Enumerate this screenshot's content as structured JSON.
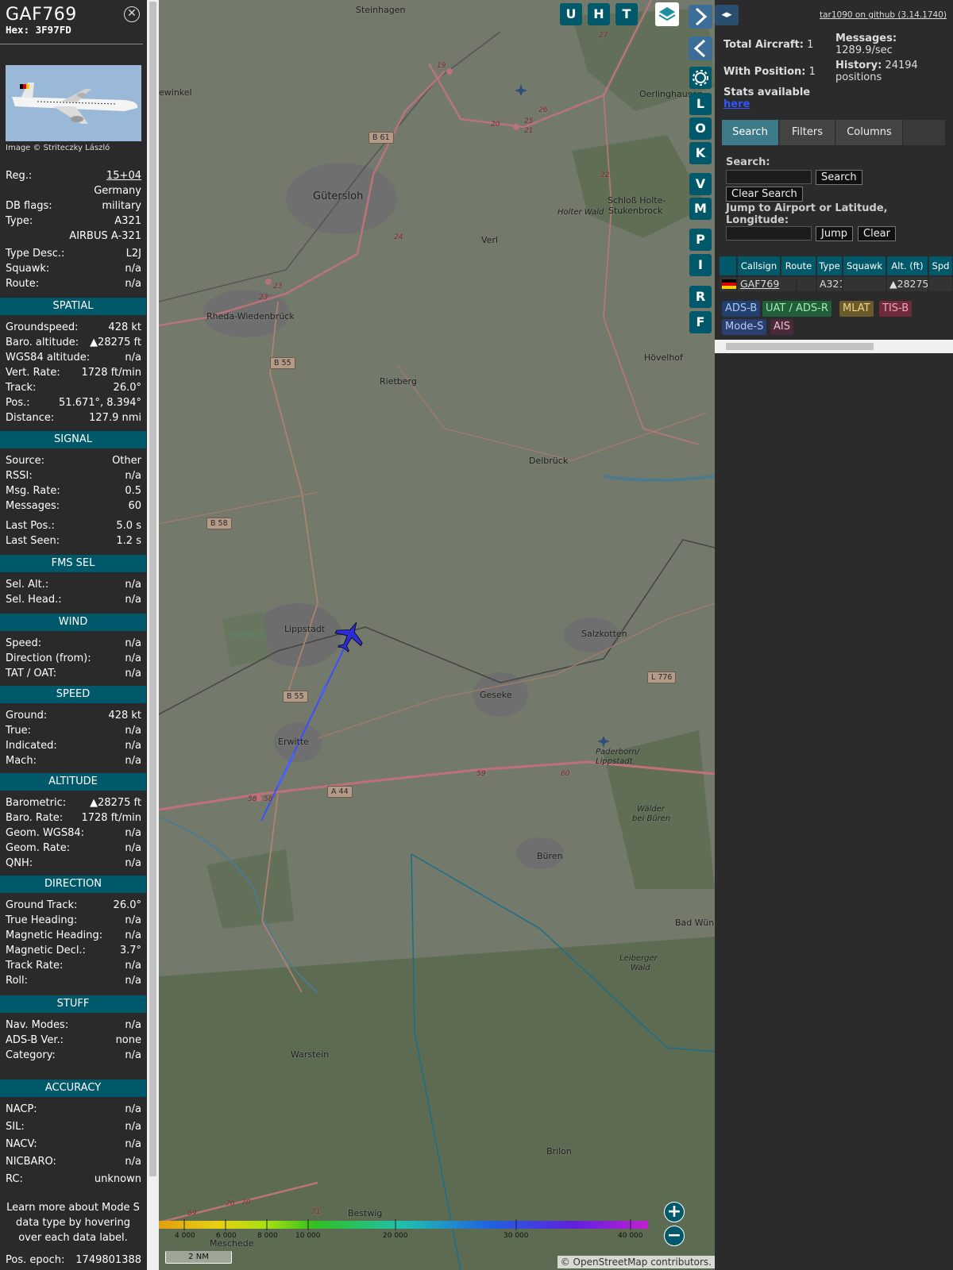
{
  "aircraft": {
    "callsign": "GAF769",
    "hex_label": "Hex: 3F97FD",
    "close_icon": "close-circle-icon",
    "image_credit": "Image © Striteczky László",
    "reg_label": "Reg.:",
    "reg_value": "15+04",
    "country": "Germany",
    "db_flags_label": "DB flags:",
    "db_flags_value": "military",
    "type_label": "Type:",
    "type_value": "A321",
    "type_full": "AIRBUS A-321",
    "type_desc_label": "Type Desc.:",
    "type_desc_value": "L2J",
    "squawk_label": "Squawk:",
    "squawk_value": "n/a",
    "route_label": "Route:",
    "route_value": "n/a"
  },
  "sections": {
    "spatial": {
      "title": "SPATIAL",
      "rows": [
        {
          "k": "Groundspeed:",
          "v": "428 kt"
        },
        {
          "k": "Baro. altitude:",
          "v": "▲28275 ft"
        },
        {
          "k": "WGS84 altitude:",
          "v": "n/a"
        },
        {
          "k": "Vert. Rate:",
          "v": "1728 ft/min"
        },
        {
          "k": "Track:",
          "v": "26.0°"
        },
        {
          "k": "Pos.:",
          "v": "51.671°, 8.394°"
        },
        {
          "k": "Distance:",
          "v": "127.9 nmi"
        }
      ]
    },
    "signal": {
      "title": "SIGNAL",
      "rows": [
        {
          "k": "Source:",
          "v": "Other"
        },
        {
          "k": "RSSI:",
          "v": "n/a"
        },
        {
          "k": "Msg. Rate:",
          "v": "0.5"
        },
        {
          "k": "Messages:",
          "v": "60"
        },
        {
          "k": "Last Pos.:",
          "v": "5.0 s"
        },
        {
          "k": "Last Seen:",
          "v": "1.2 s"
        }
      ]
    },
    "fms": {
      "title": "FMS SEL",
      "rows": [
        {
          "k": "Sel. Alt.:",
          "v": "n/a"
        },
        {
          "k": "Sel. Head.:",
          "v": "n/a"
        }
      ]
    },
    "wind": {
      "title": "WIND",
      "rows": [
        {
          "k": "Speed:",
          "v": "n/a"
        },
        {
          "k": "Direction (from):",
          "v": "n/a"
        },
        {
          "k": "TAT / OAT:",
          "v": "n/a"
        }
      ]
    },
    "speed": {
      "title": "SPEED",
      "rows": [
        {
          "k": "Ground:",
          "v": "428 kt"
        },
        {
          "k": "True:",
          "v": "n/a"
        },
        {
          "k": "Indicated:",
          "v": "n/a"
        },
        {
          "k": "Mach:",
          "v": "n/a"
        }
      ]
    },
    "altitude": {
      "title": "ALTITUDE",
      "rows": [
        {
          "k": "Barometric:",
          "v": "▲28275 ft"
        },
        {
          "k": "Baro. Rate:",
          "v": "1728 ft/min"
        },
        {
          "k": "Geom. WGS84:",
          "v": "n/a"
        },
        {
          "k": "Geom. Rate:",
          "v": "n/a"
        },
        {
          "k": "QNH:",
          "v": "n/a"
        }
      ]
    },
    "direction": {
      "title": "DIRECTION",
      "rows": [
        {
          "k": "Ground Track:",
          "v": "26.0°"
        },
        {
          "k": "True Heading:",
          "v": "n/a"
        },
        {
          "k": "Magnetic Heading:",
          "v": "n/a"
        },
        {
          "k": "Magnetic Decl.:",
          "v": "3.7°"
        },
        {
          "k": "Track Rate:",
          "v": "n/a"
        },
        {
          "k": "Roll:",
          "v": "n/a"
        }
      ]
    },
    "stuff": {
      "title": "STUFF",
      "rows": [
        {
          "k": "Nav. Modes:",
          "v": "n/a"
        },
        {
          "k": "ADS-B Ver.:",
          "v": "none"
        },
        {
          "k": "Category:",
          "v": "n/a"
        }
      ]
    },
    "accuracy": {
      "title": "ACCURACY",
      "rows": [
        {
          "k": "NACP:",
          "v": "n/a"
        },
        {
          "k": "SIL:",
          "v": "n/a"
        },
        {
          "k": "NACV:",
          "v": "n/a"
        },
        {
          "k": "NICBARO:",
          "v": "n/a"
        },
        {
          "k": "RC:",
          "v": "unknown"
        }
      ]
    }
  },
  "learn_more": "Learn more about Mode S data type by hovering over each data label.",
  "pos_epoch_label": "Pos. epoch:",
  "pos_epoch_value": "1749801388",
  "map": {
    "top_buttons": [
      "U",
      "H",
      "T"
    ],
    "layers_icon": "layers-icon",
    "side_buttons": [
      "L",
      "O",
      "K",
      "V",
      "M",
      "P",
      "I",
      "R",
      "F"
    ],
    "settings_icon": "gear-icon",
    "expand_icon": "chevron-right-icon",
    "collapse_icon": "chevron-left-icon",
    "places": [
      {
        "name": "Steinhagen"
      },
      {
        "name": "ewinkel"
      },
      {
        "name": "Gütersloh"
      },
      {
        "name": "Oerlinghausen"
      },
      {
        "name": "Schloß Holte-"
      },
      {
        "name": "Stukenbrock"
      },
      {
        "name": "Holter Wald"
      },
      {
        "name": "Verl"
      },
      {
        "name": "Rheda-Wiedenbrück"
      },
      {
        "name": "Rietberg"
      },
      {
        "name": "Hövelhof"
      },
      {
        "name": "Delbrück"
      },
      {
        "name": "Lippstadt"
      },
      {
        "name": "Lippeaue"
      },
      {
        "name": "Salzkotten"
      },
      {
        "name": "Geseke"
      },
      {
        "name": "Erwitte"
      },
      {
        "name": "Paderborn/"
      },
      {
        "name": "Lippstadt"
      },
      {
        "name": "Büren"
      },
      {
        "name": "Wälder"
      },
      {
        "name": "bei Büren"
      },
      {
        "name": "Bad Wünn"
      },
      {
        "name": "Leiberger"
      },
      {
        "name": "Wald"
      },
      {
        "name": "Warstein"
      },
      {
        "name": "Brilon"
      },
      {
        "name": "Bestwig"
      },
      {
        "name": "Meschede"
      }
    ],
    "road_signs": [
      "B 61",
      "B 55",
      "B 58",
      "B 55",
      "A 44",
      "L 776"
    ],
    "junction_numbers": [
      "27",
      "19",
      "26",
      "25",
      "20",
      "21",
      "22",
      "24",
      "23",
      "23",
      "58",
      "58",
      "59",
      "60",
      "69",
      "70",
      "70",
      "71"
    ],
    "altitude_ticks": [
      "4 000",
      "6 000",
      "8 000",
      "10 000",
      "20 000",
      "30 000",
      "40 000"
    ],
    "scale_label": "2 NM",
    "attribution": "© OpenStreetMap contributors.",
    "zoom_in": "+",
    "zoom_out": "−"
  },
  "sidebar": {
    "github_link": "tar1090 on github (3.14.1740)",
    "collapse_icon": "expand-collapse-icon",
    "total_aircraft_label": "Total Aircraft:",
    "total_aircraft_value": "1",
    "with_position_label": "With Position:",
    "with_position_value": "1",
    "messages_label": "Messages:",
    "messages_value": "1289.9/sec",
    "history_label": "History:",
    "history_value": "24194",
    "history_unit": "positions",
    "stats_text": "Stats available",
    "stats_link": "here",
    "tabs": [
      "Search",
      "Filters",
      "Columns"
    ],
    "search_label": "Search:",
    "search_button": "Search",
    "clear_search_button": "Clear Search",
    "jump_label": "Jump to Airport or Latitude, Longitude:",
    "jump_button": "Jump",
    "clear_button": "Clear",
    "table": {
      "columns": [
        "Callsign",
        "Route",
        "Type",
        "Squawk",
        "Alt. (ft)",
        "Spd"
      ],
      "rows": [
        {
          "flag": "germany-flag-icon",
          "callsign": "GAF769",
          "route": "",
          "type": "A321",
          "squawk": "",
          "alt": "▲28275",
          "spd": ""
        }
      ]
    },
    "sources": [
      {
        "label": "ADS-B",
        "color": "#233f6e",
        "text_color": "#a9c8f0"
      },
      {
        "label": "UAT / ADS-R",
        "color": "#1f5f3a",
        "text_color": "#a8e6b5"
      },
      {
        "label": "MLAT",
        "color": "#6b5a2a",
        "text_color": "#f0d58a"
      },
      {
        "label": "TIS-B",
        "color": "#6e2a3a",
        "text_color": "#f0a8b8"
      },
      {
        "label": "Mode-S",
        "color": "#2a3f6e",
        "text_color": "#b4c8f0"
      },
      {
        "label": "AIS",
        "color": "#4a2a3a",
        "text_color": "#f0c0d0"
      }
    ]
  },
  "colors": {
    "accent": "#00596b",
    "panel_bg": "#2a2a2a",
    "map_bg": "#737a6c",
    "track_line": "#3b4fff",
    "plane": "#2d2dd8"
  }
}
